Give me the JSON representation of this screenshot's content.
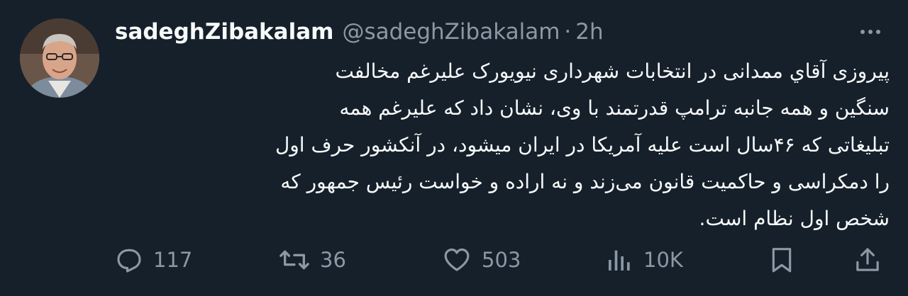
{
  "tweet": {
    "display_name": "sadeghZibakalam",
    "handle": "@sadeghZibakalam",
    "separator": "·",
    "time": "2h",
    "more_icon": "more-horizontal-icon",
    "text_lines": [
      "پیروزی آقاي ممدانی در انتخابات شهرداری نیویورک علیرغم مخالفت",
      "سنگین و همه جانبه ترامپ قدرتمند با وی، نشان داد که علیرغم همه",
      "تبلیغاتی که ۴۶سال است علیه آمریکا در ایران میشود، در آنکشور حرف اول",
      "را دمکراسی  و حاکمیت قانون می‌زند و نه اراده و خواست رئیس جمهور که",
      "شخص اول نظام است."
    ]
  },
  "actions": {
    "reply": {
      "icon": "reply-icon",
      "count": "117"
    },
    "retweet": {
      "icon": "retweet-icon",
      "count": "36"
    },
    "like": {
      "icon": "heart-icon",
      "count": "503"
    },
    "views": {
      "icon": "views-icon",
      "count": "10K"
    },
    "bookmark": {
      "icon": "bookmark-icon"
    },
    "share": {
      "icon": "share-icon"
    }
  },
  "colors": {
    "background": "#15202b",
    "text_primary": "#f7f9f9",
    "text_secondary": "#8b98a5"
  }
}
